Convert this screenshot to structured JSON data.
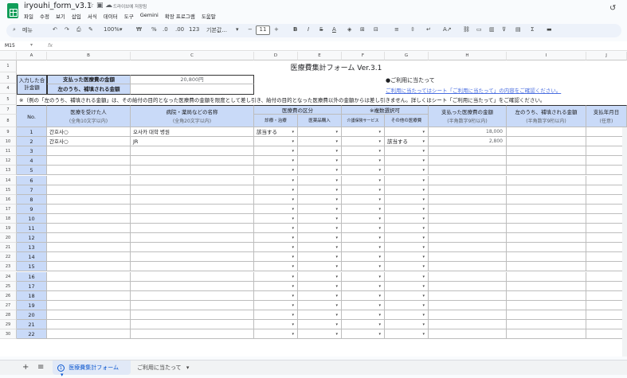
{
  "app": {
    "doc_name": "iryouhi_form_v3.1",
    "saved_status": "드라이브에 저장됨",
    "menu": [
      "파일",
      "수정",
      "보기",
      "삽입",
      "서식",
      "데이터",
      "도구",
      "Gemini",
      "확장 프로그램",
      "도움말"
    ]
  },
  "toolbar": {
    "search_label": "메뉴",
    "zoom": "100%",
    "currency": "₩",
    "percent": "%",
    "dec_decrease": ".0",
    "dec_increase": ".00",
    "number_format": "123",
    "font": "기본값...",
    "font_size": "11",
    "bold": "B",
    "italic": "I",
    "strike": "S",
    "text_color": "A"
  },
  "formula_bar": {
    "cell_ref": "M15",
    "fx": "fx",
    "value": ""
  },
  "columns": [
    "A",
    "B",
    "C",
    "D",
    "E",
    "F",
    "G",
    "H",
    "I",
    "J"
  ],
  "row_numbers": [
    "1",
    "3",
    "4",
    "5",
    "7",
    "8",
    "9",
    "10",
    "11",
    "12",
    "13",
    "14",
    "15",
    "16",
    "17",
    "18",
    "19",
    "20",
    "21",
    "22",
    "23",
    "24",
    "25",
    "26",
    "27",
    "28",
    "29",
    "30"
  ],
  "sheet": {
    "title": "医療費集計フォーム Ver.3.1",
    "left_box_label": "入力した合計金額",
    "paid_label": "支払った医療費の金額",
    "paid_value": "20,800円",
    "covered_label": "左のうち、補填される金額",
    "notice_title": "●ご利用に当たって",
    "notice_link": "ご利用に当たってはシート「ご利用に当たって」の内容をご確認ください。",
    "note_row": "※（例の「左のうち、補填される金額」は、その給付の目的となった医療費の金額を限度として差し引き、給付の目的となった医療費以外の金額からは差し引きません。詳しくはシート「ご利用に当たって」をご確認ください。",
    "headers": {
      "no": "No.",
      "person": "医療を受けた人",
      "person_sub": "(全角10文字以内)",
      "hospital": "病院・薬局などの名称",
      "hospital_sub": "(全角20文字以内)",
      "category": "医療費の区分",
      "category_sub": "※複数選択可",
      "cat1": "診療・治療",
      "cat2": "医薬品購入",
      "cat3": "介護保険サービス",
      "cat4": "その他の医療費",
      "paid": "支払った医療費の金額",
      "paid_sub": "(半角数字9桁以内)",
      "covered": "左のうち、補填される金額",
      "covered_sub": "(半角数字9桁以内)",
      "date": "支払年月日",
      "date_sub": "(任意)"
    },
    "rows": [
      {
        "no": "1",
        "person": "간호사○",
        "hospital": "오사카 대학 병원",
        "cat1": "該当する",
        "cat2": "",
        "cat3": "",
        "cat4": "",
        "paid": "18,000"
      },
      {
        "no": "2",
        "person": "간호사○",
        "hospital": "JR",
        "cat1": "",
        "cat2": "",
        "cat3": "",
        "cat4": "該当する",
        "paid": "2,800"
      },
      {
        "no": "3"
      },
      {
        "no": "4"
      },
      {
        "no": "5"
      },
      {
        "no": "6"
      },
      {
        "no": "7"
      },
      {
        "no": "8"
      },
      {
        "no": "9"
      },
      {
        "no": "10"
      },
      {
        "no": "11"
      },
      {
        "no": "12"
      },
      {
        "no": "13"
      },
      {
        "no": "14"
      },
      {
        "no": "15"
      },
      {
        "no": "16"
      },
      {
        "no": "17"
      },
      {
        "no": "18"
      },
      {
        "no": "19"
      },
      {
        "no": "20"
      },
      {
        "no": "21"
      },
      {
        "no": "22"
      }
    ]
  },
  "tabs": {
    "add": "+",
    "list": "≡",
    "sheet1": "医療費集計フォーム",
    "sheet1_badge": "1",
    "sheet2": "ご利用に当たって"
  }
}
